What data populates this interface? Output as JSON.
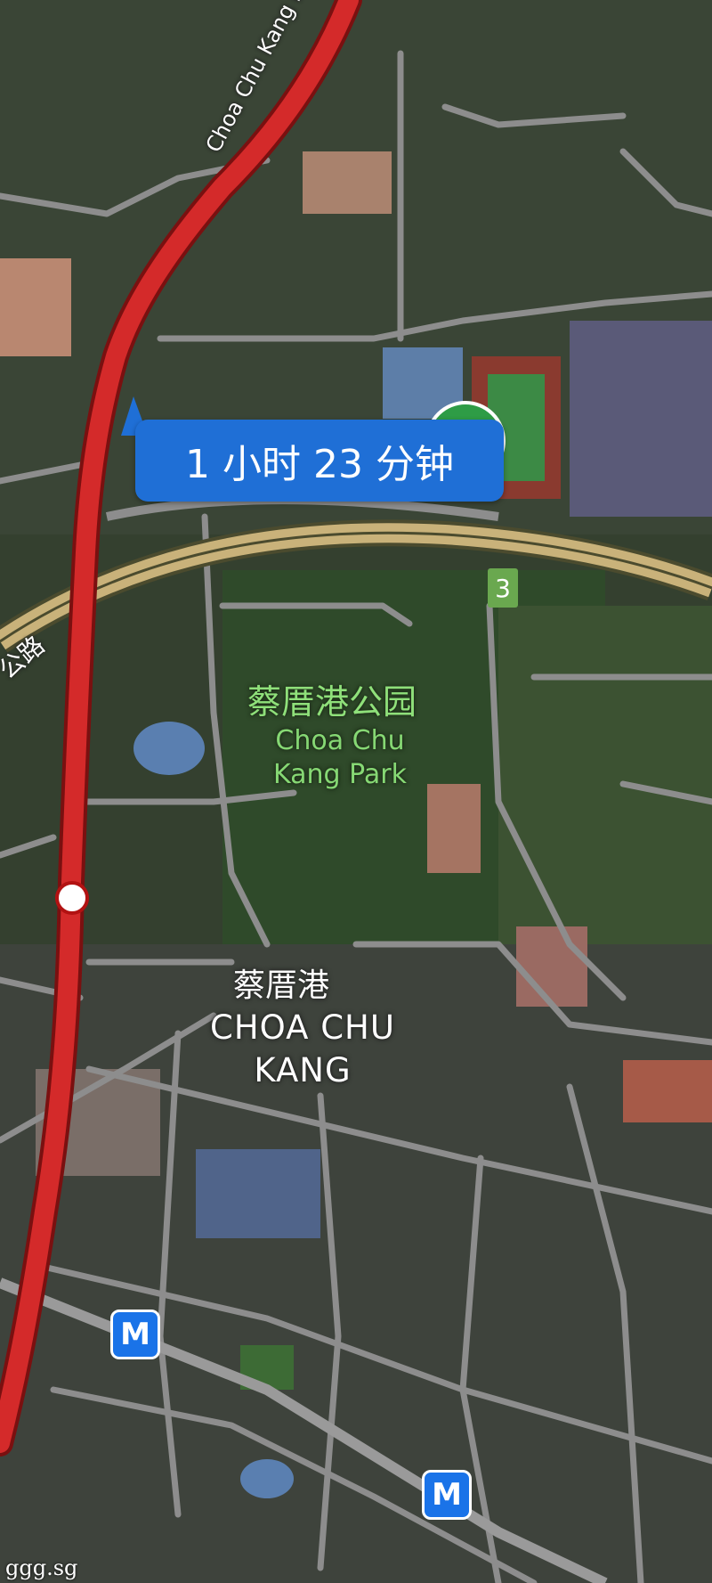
{
  "map": {
    "travel_time": "1 小时 23 分钟",
    "road_label": "Choa Chu Kang Dr",
    "road_label_partial": "公路",
    "park_name_cn": "蔡厝港公园",
    "park_name_en": "Choa Chu Kang Park",
    "area_name_cn": "蔡厝港",
    "area_name_en": "CHOA CHU KANG",
    "route_badge": "3",
    "metro_symbol_1": "M",
    "metro_symbol_2": "M",
    "watermark": "ggg.sg"
  },
  "colors": {
    "route": "#d42a2a",
    "bubble": "#1f6fd6",
    "expressway": "#c9b27a",
    "road": "#8d8d8d",
    "park_text": "#8fe07a",
    "metro": "#1a73e8"
  },
  "icons": {
    "metro": "metro-station-icon",
    "destination": "destination-marker-icon",
    "route_point": "route-point-icon"
  }
}
